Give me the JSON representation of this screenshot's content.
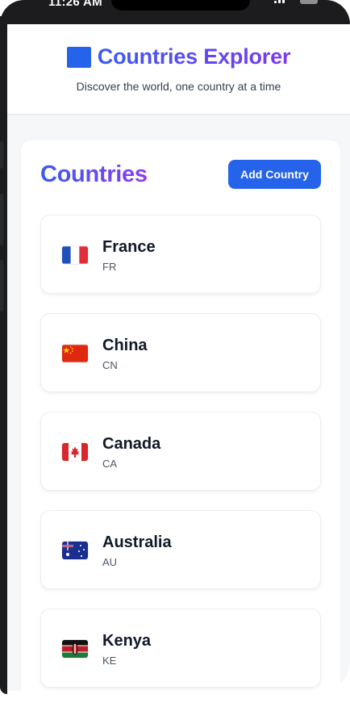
{
  "status_bar": {
    "time": "11:26 AM"
  },
  "header": {
    "title": "Countries Explorer",
    "subtitle": "Discover the world, one country at a time"
  },
  "main": {
    "section_title": "Countries",
    "add_button_label": "Add Country",
    "countries": [
      {
        "name": "France",
        "code": "FR"
      },
      {
        "name": "China",
        "code": "CN"
      },
      {
        "name": "Canada",
        "code": "CA"
      },
      {
        "name": "Australia",
        "code": "AU"
      },
      {
        "name": "Kenya",
        "code": "KE"
      }
    ]
  },
  "colors": {
    "accent": "#2563eb",
    "title_gradient_start": "#3b5bf0",
    "title_gradient_end": "#7c3aed",
    "background": "#f6f7f9"
  }
}
